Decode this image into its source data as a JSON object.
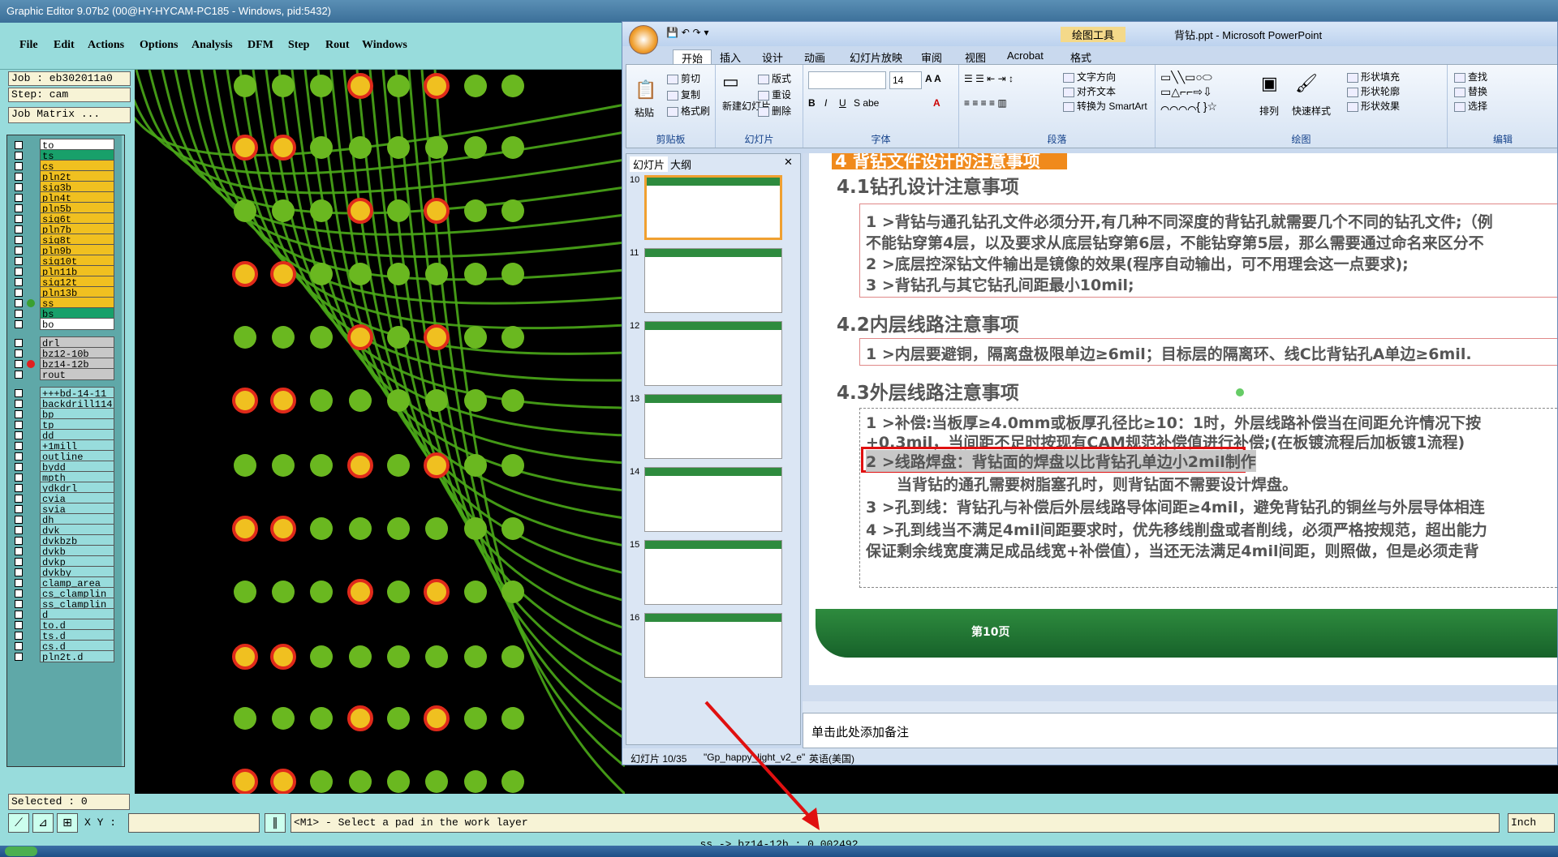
{
  "editor": {
    "title": "Graphic Editor 9.07b2 (00@HY-HYCAM-PC185 - Windows, pid:5432)",
    "menu": [
      "File",
      "Edit",
      "Actions",
      "Options",
      "Analysis",
      "DFM",
      "Step",
      "Rout",
      "Windows"
    ],
    "job": "Job : eb302011a0",
    "step": "Step: cam",
    "job_matrix": "Job Matrix ...",
    "layers": [
      "to",
      "ts",
      "cs",
      "pln2t",
      "sig3b",
      "pln4t",
      "pln5b",
      "sig6t",
      "pln7b",
      "sig8t",
      "pln9b",
      "sig10t",
      "pln11b",
      "sig12t",
      "pln13b",
      "ss",
      "bs",
      "bo",
      "drl",
      "bz12-10b",
      "bz14-12b",
      "rout",
      "+++bd-14-11",
      "backdrill114",
      "bp",
      "tp",
      "dd",
      "+1mill",
      "outline",
      "bydd",
      "mpth",
      "ydkdrl",
      "cvia",
      "svia",
      "dh",
      "dvk",
      "dvkbzb",
      "dvkb",
      "dvkp",
      "dvkby",
      "clamp_area",
      "cs_clamplin",
      "ss_clamplin",
      "d",
      "to.d",
      "ts.d",
      "cs.d",
      "pln2t.d"
    ],
    "selected": "Selected : 0",
    "xy_label": "X Y :",
    "prompt": "<M1> - Select a pad in the work layer",
    "units": "Inch",
    "status": "ss -> bz14-12b : 0.002492",
    "y_label": "Y",
    "colors": {
      "bg": "#98dcdc",
      "pad_green": "#6ab820",
      "pad_red": "#e02a1a",
      "pad_yellow": "#f0c020",
      "trace": "#4aa818"
    }
  },
  "ppt": {
    "title": "背钻.ppt - Microsoft PowerPoint",
    "context_tab": "绘图工具",
    "tabs": [
      "开始",
      "插入",
      "设计",
      "动画",
      "幻灯片放映",
      "审阅",
      "视图",
      "Acrobat",
      "格式"
    ],
    "ribbon": {
      "clipboard": {
        "label": "剪贴板",
        "paste": "粘贴",
        "cut": "剪切",
        "copy": "复制",
        "format": "格式刷"
      },
      "slides": {
        "label": "幻灯片",
        "new": "新建幻灯片",
        "layout": "版式",
        "reset": "重设",
        "delete": "删除"
      },
      "font": {
        "label": "字体",
        "size": "14"
      },
      "paragraph": {
        "label": "段落",
        "direction": "文字方向",
        "align": "对齐文本",
        "smartart": "转换为 SmartArt"
      },
      "drawing": {
        "label": "绘图",
        "arrange": "排列",
        "quick": "快速样式",
        "fill": "形状填充",
        "outline": "形状轮廓",
        "effect": "形状效果"
      },
      "editing": {
        "label": "编辑",
        "find": "查找",
        "replace": "替换",
        "select": "选择"
      }
    },
    "pane_tabs": [
      "幻灯片",
      "大纲"
    ],
    "thumb_numbers": [
      "10",
      "11",
      "12",
      "13",
      "14",
      "15",
      "16"
    ],
    "slide": {
      "header": "4  背钻文件设计的注意事项",
      "s41": "4.1钻孔设计注意事项",
      "s41_items": [
        "1 >背钻与通孔钻孔文件必须分开,有几种不同深度的背钻孔就需要几个不同的钻孔文件;（例",
        "不能钻穿第4层，以及要求从底层钻穿第6层，不能钻穿第5层，那么需要通过命名来区分不",
        "2 >底层控深钻文件输出是镜像的效果(程序自动输出，可不用理会这一点要求);",
        "3 >背钻孔与其它钻孔间距最小10mil;"
      ],
      "s42": "4.2内层线路注意事项",
      "s42_items": [
        "1 >内层要避铜，隔离盘极限单边≥6mil；目标层的隔离环、线C比背钻孔A单边≥6mil."
      ],
      "s43": "4.3外层线路注意事项",
      "s43_items": [
        "1 >补偿:当板厚≥4.0mm或板厚孔径比≥10：1时，外层线路补偿当在间距允许情况下按",
        "+0.3mil，当间距不足时按现有CAM规范补偿值进行补偿;(在板镀流程后加板镀1流程)",
        "2 >线路焊盘：背钻面的焊盘以比背钻孔单边小2mil制作",
        "当背钻的通孔需要树脂塞孔时，则背钻面不需要设计焊盘。",
        "3 >孔到线：背钻孔与补偿后外层线路导体间距≥4mil，避免背钻孔的铜丝与外层导体相连",
        "4 >孔到线当不满足4mil间距要求时，优先移线削盘或者削线，必须严格按规范，超出能力",
        "保证剩余线宽度满足成品线宽+补偿值），当还无法满足4mil间距，则照做，但是必须走背"
      ],
      "page": "第10页"
    },
    "notes": "单击此处添加备注",
    "status": {
      "slide": "幻灯片 10/35",
      "theme": "\"Gp_happy_light_v2_e\"",
      "lang": "英语(美国)"
    }
  }
}
